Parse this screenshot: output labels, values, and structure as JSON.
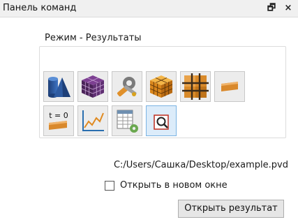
{
  "panel": {
    "title": "Панель команд",
    "float_button": "🗗",
    "close_button": "×"
  },
  "mode_group": {
    "title": "Режим - Результаты",
    "tools": [
      {
        "icon": "geometry-shapes-icon"
      },
      {
        "icon": "mesh-cube-icon"
      },
      {
        "icon": "settings-tools-icon"
      },
      {
        "icon": "solid-mesh-cube-icon"
      },
      {
        "icon": "grid-partition-icon"
      },
      {
        "icon": "beam-section-icon"
      },
      {
        "icon": "time-step-icon",
        "text": "t = 0"
      },
      {
        "icon": "plot-graph-icon"
      },
      {
        "icon": "table-settings-icon"
      },
      {
        "icon": "magnify-results-icon",
        "active": true
      }
    ]
  },
  "file_path": "C:/Users/Сашка/Desktop/example.pvd",
  "open_new_window": {
    "label": "Открыть в новом окне",
    "checked": false
  },
  "open_button": "Открыть результат",
  "colors": {
    "accent": "#7ab3e3",
    "mesh_blue": "#2a5a99",
    "mesh_purple": "#5b2e6e",
    "orange": "#e0902a"
  }
}
